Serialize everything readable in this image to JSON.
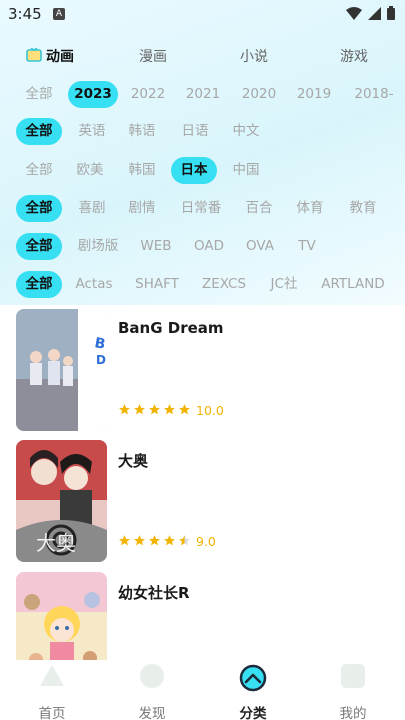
{
  "status": {
    "time": "3:45",
    "notif_letter": "A"
  },
  "category_tabs": [
    {
      "label": "动画",
      "active": true
    },
    {
      "label": "漫画",
      "active": false
    },
    {
      "label": "小说",
      "active": false
    },
    {
      "label": "游戏",
      "active": false
    }
  ],
  "filters": {
    "year": [
      "全部",
      "2023",
      "2022",
      "2021",
      "2020",
      "2019",
      "2018-"
    ],
    "language": [
      "全部",
      "英语",
      "韩语",
      "日语",
      "中文"
    ],
    "region": [
      "全部",
      "欧美",
      "韩国",
      "日本",
      "中国"
    ],
    "genre": [
      "全部",
      "喜剧",
      "剧情",
      "日常番",
      "百合",
      "体育",
      "教育"
    ],
    "format": [
      "全部",
      "剧场版",
      "WEB",
      "OAD",
      "OVA",
      "TV"
    ],
    "studio": [
      "全部",
      "Actas",
      "SHAFT",
      "ZEXCS",
      "JC社",
      "ARTLAND"
    ]
  },
  "items": [
    {
      "title": "BanG Dream",
      "score": "10.0",
      "stars": 5
    },
    {
      "title": "大奥",
      "score": "9.0",
      "stars": 4.5
    },
    {
      "title": "幼女社长R",
      "score": "",
      "stars": 0
    }
  ],
  "bottom_nav": [
    {
      "label": "首页",
      "active": false
    },
    {
      "label": "发现",
      "active": false
    },
    {
      "label": "分类",
      "active": true
    },
    {
      "label": "我的",
      "active": false
    }
  ],
  "colors": {
    "accent": "#36dff2",
    "star": "#f1b400",
    "nav_active_bg": "#d8e9ff"
  }
}
